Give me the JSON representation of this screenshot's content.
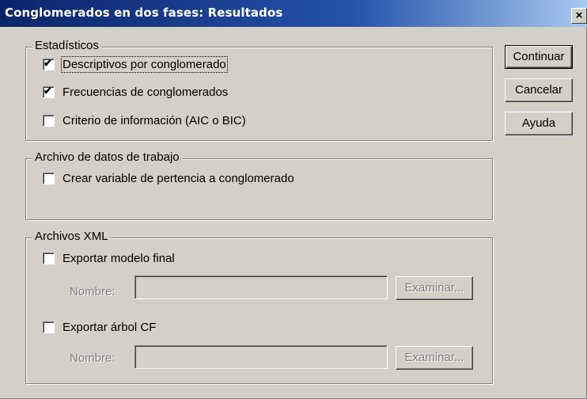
{
  "window": {
    "title": "Conglomerados en dos fases: Resultados",
    "close_glyph": "×"
  },
  "groups": {
    "estadisticos": {
      "legend": "Estadísticos",
      "items": [
        {
          "label": "Descriptivos por conglomerado",
          "checked": true
        },
        {
          "label": "Frecuencias de conglomerados",
          "checked": true
        },
        {
          "label": "Criterio de información (AIC o BIC)",
          "checked": false
        }
      ]
    },
    "archivo": {
      "legend": "Archivo de datos de trabajo",
      "items": [
        {
          "label": "Crear variable de pertencia a conglomerado",
          "checked": false
        }
      ]
    },
    "xml": {
      "legend": "Archivos XML",
      "export_model": {
        "label": "Exportar modelo final",
        "checked": false,
        "name_label": "Nombre:",
        "browse": "Examinar..."
      },
      "export_tree": {
        "label": "Exportar árbol CF",
        "checked": false,
        "name_label": "Nombre:",
        "browse": "Examinar..."
      }
    }
  },
  "buttons": {
    "continue": "Continuar",
    "cancel": "Cancelar",
    "help": "Ayuda"
  },
  "check_glyph": "✔"
}
